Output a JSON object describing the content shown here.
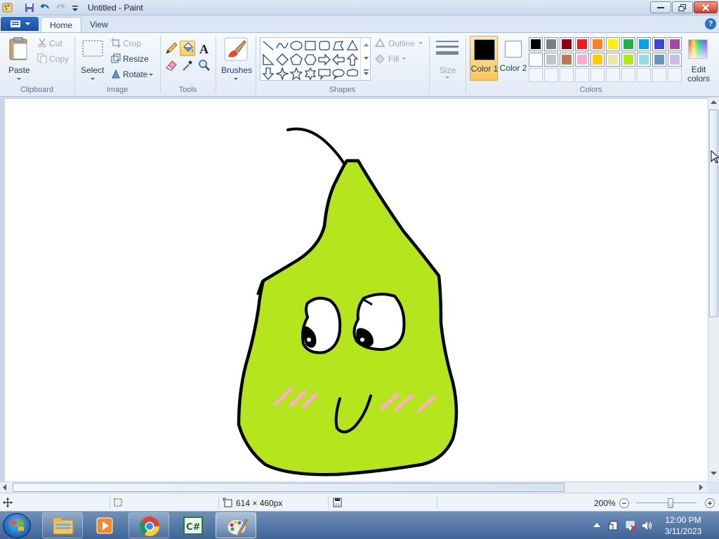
{
  "window": {
    "title": "Untitled - Paint",
    "quick_access": [
      "paint-app-icon",
      "save-icon",
      "undo-icon",
      "redo-icon",
      "customize-quick-access-icon"
    ]
  },
  "tabs": [
    {
      "label": "Home",
      "active": true
    },
    {
      "label": "View",
      "active": false
    }
  ],
  "ribbon": {
    "clipboard": {
      "group_label": "Clipboard",
      "paste": "Paste",
      "cut": "Cut",
      "copy": "Copy"
    },
    "image": {
      "group_label": "Image",
      "select": "Select",
      "crop": "Crop",
      "resize": "Resize",
      "rotate": "Rotate"
    },
    "tools": {
      "group_label": "Tools",
      "items": [
        "pencil-icon",
        "fill-icon",
        "text-icon",
        "eraser-icon",
        "color-picker-icon",
        "magnifier-icon"
      ],
      "selected": "fill-icon"
    },
    "brushes": {
      "label": "Brushes"
    },
    "shapes": {
      "group_label": "Shapes",
      "outline": "Outline",
      "fill": "Fill",
      "size": "Size"
    },
    "colors": {
      "group_label": "Colors",
      "color1_label": "Color 1",
      "color2_label": "Color 2",
      "color1": "#000000",
      "color2": "#ffffff",
      "edit_colors": "Edit colors",
      "palette_row1": [
        "#000000",
        "#7f7f7f",
        "#880015",
        "#ed1c24",
        "#ff7f27",
        "#fff200",
        "#22b14c",
        "#00a2e8",
        "#3f48cc",
        "#a349a4"
      ],
      "palette_row2": [
        "#ffffff",
        "#c3c3c3",
        "#b97a57",
        "#ffaec9",
        "#ffc90e",
        "#efe4b0",
        "#b5e61d",
        "#99d9ea",
        "#7092be",
        "#c8bfe7"
      ]
    }
  },
  "drawing": {
    "description_colors": {
      "body": "#b5e61d",
      "outline": "#000000",
      "blush": "#ffaec9"
    }
  },
  "status": {
    "canvas_size": "614 × 460px",
    "zoom": "200%"
  },
  "taskbar": {
    "apps": [
      "file-explorer-icon",
      "media-player-icon",
      "chrome-icon",
      "csharp-editor-icon",
      "paint-icon"
    ],
    "time": "12:00 PM",
    "date": "3/11/2023"
  }
}
